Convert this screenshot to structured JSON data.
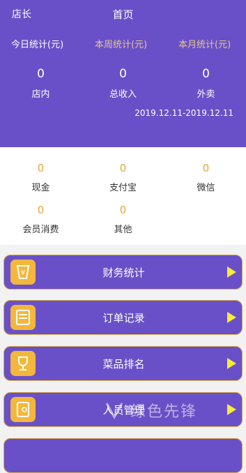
{
  "header": {
    "role": "店长",
    "title": "首页",
    "tabs": [
      "今日统计(元)",
      "本周统计(元)",
      "本月统计(元)"
    ],
    "stats": [
      {
        "value": "0",
        "label": "店内"
      },
      {
        "value": "0",
        "label": "总收入"
      },
      {
        "value": "0",
        "label": "外卖"
      }
    ],
    "date_range": "2019.12.11-2019.12.11"
  },
  "payments": [
    {
      "value": "0",
      "label": "现金"
    },
    {
      "value": "0",
      "label": "支付宝"
    },
    {
      "value": "0",
      "label": "微信"
    },
    {
      "value": "0",
      "label": "会员消费"
    },
    {
      "value": "0",
      "label": "其他"
    }
  ],
  "menu": [
    {
      "label": "财务统计",
      "icon": "finance-icon"
    },
    {
      "label": "订单记录",
      "icon": "order-icon"
    },
    {
      "label": "菜品排名",
      "icon": "trophy-icon"
    },
    {
      "label": "人员管理",
      "icon": "staff-icon"
    }
  ],
  "watermark": "绿色先锋",
  "colors": {
    "primary": "#6a50c8",
    "accent": "#f3b73c",
    "value": "#e6a43a",
    "arrow": "#f4ec37"
  }
}
